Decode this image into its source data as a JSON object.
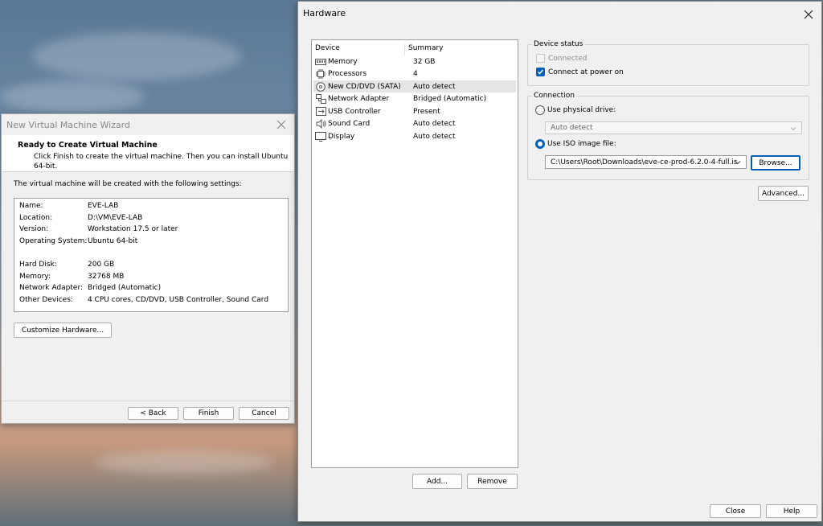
{
  "wizard": {
    "title": "New Virtual Machine Wizard",
    "header_title": "Ready to Create Virtual Machine",
    "header_subtitle": "Click Finish to create the virtual machine. Then you can install Ubuntu 64-bit.",
    "intro": "The virtual machine will be created with the following settings:",
    "settings": [
      {
        "key": "Name:",
        "value": "EVE-LAB"
      },
      {
        "key": "Location:",
        "value": "D:\\VM\\EVE-LAB"
      },
      {
        "key": "Version:",
        "value": "Workstation 17.5 or later"
      },
      {
        "key": "Operating System:",
        "value": "Ubuntu 64-bit"
      },
      {
        "key": "Hard Disk:",
        "value": "200 GB"
      },
      {
        "key": "Memory:",
        "value": "32768 MB"
      },
      {
        "key": "Network Adapter:",
        "value": "Bridged (Automatic)"
      },
      {
        "key": "Other Devices:",
        "value": "4 CPU cores, CD/DVD, USB Controller, Sound Card"
      }
    ],
    "customize_label": "Customize Hardware...",
    "back_label": "< Back",
    "finish_label": "Finish",
    "cancel_label": "Cancel"
  },
  "hardware": {
    "title": "Hardware",
    "col_device": "Device",
    "col_summary": "Summary",
    "devices": [
      {
        "name": "Memory",
        "summary": "32 GB",
        "icon": "memory-icon"
      },
      {
        "name": "Processors",
        "summary": "4",
        "icon": "processor-icon"
      },
      {
        "name": "New CD/DVD (SATA)",
        "summary": "Auto detect",
        "icon": "cd-dvd-icon",
        "selected": true
      },
      {
        "name": "Network Adapter",
        "summary": "Bridged (Automatic)",
        "icon": "network-icon"
      },
      {
        "name": "USB Controller",
        "summary": "Present",
        "icon": "usb-icon"
      },
      {
        "name": "Sound Card",
        "summary": "Auto detect",
        "icon": "speaker-icon"
      },
      {
        "name": "Display",
        "summary": "Auto detect",
        "icon": "monitor-icon"
      }
    ],
    "add_label": "Add...",
    "remove_label": "Remove",
    "device_status": {
      "label": "Device status",
      "connected": "Connected",
      "connect_at_power_on": "Connect at power on"
    },
    "connection": {
      "label": "Connection",
      "use_physical": "Use physical drive:",
      "physical_value": "Auto detect",
      "use_iso": "Use ISO image file:",
      "iso_path": "C:\\Users\\Root\\Downloads\\eve-ce-prod-6.2.0-4-full.is",
      "browse_label": "Browse..."
    },
    "advanced_label": "Advanced...",
    "close_label": "Close",
    "help_label": "Help"
  },
  "colors": {
    "accent": "#005fb8",
    "selection": "#e5e5e5"
  }
}
